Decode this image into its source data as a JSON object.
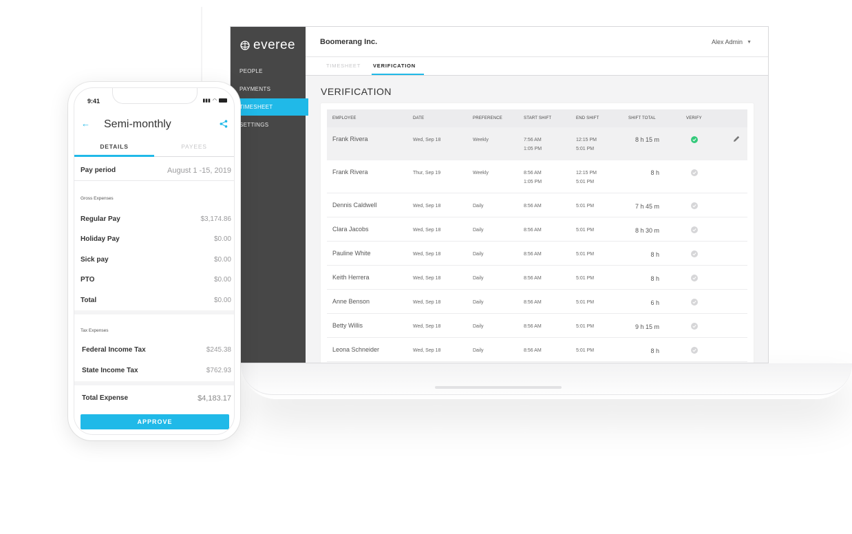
{
  "app": {
    "brand": "everee",
    "company": "Boomerang Inc.",
    "user": "Alex Admin"
  },
  "sidebar": {
    "items": [
      {
        "label": "PEOPLE"
      },
      {
        "label": "PAYMENTS"
      },
      {
        "label": "TIMESHEET",
        "active": true
      },
      {
        "label": "SETTINGS"
      }
    ]
  },
  "tabs": {
    "timesheet": "TIMESHEET",
    "verification": "VERIFICATION"
  },
  "main": {
    "title": "VERIFICATION",
    "columns": [
      "EMPLOYEE",
      "DATE",
      "PREFERENCE",
      "START SHIFT",
      "END SHIFT",
      "SHIFT TOTAL",
      "VERIFY"
    ],
    "rows": [
      {
        "employee": "Frank Rivera",
        "date": "Wed, Sep 18",
        "preference": "Weekly",
        "start": "7:56 AM",
        "start2": "1:05 PM",
        "end": "12:15 PM",
        "end2": "5:01 PM",
        "total": "8 h 15 m",
        "verified": true
      },
      {
        "employee": "Frank Rivera",
        "date": "Thur, Sep 19",
        "preference": "Weekly",
        "start": "8:56 AM",
        "start2": "1:05 PM",
        "end": "12:15 PM",
        "end2": "5:01 PM",
        "total": "8 h",
        "verified": false
      },
      {
        "employee": "Dennis Caldwell",
        "date": "Wed, Sep 18",
        "preference": "Daily",
        "start": "8:56 AM",
        "end": "5:01 PM",
        "total": "7 h 45 m",
        "verified": false
      },
      {
        "employee": "Clara Jacobs",
        "date": "Wed, Sep 18",
        "preference": "Daily",
        "start": "8:56 AM",
        "end": "5:01 PM",
        "total": "8 h 30 m",
        "verified": false
      },
      {
        "employee": "Pauline White",
        "date": "Wed, Sep 18",
        "preference": "Daily",
        "start": "8:56 AM",
        "end": "5:01 PM",
        "total": "8 h",
        "verified": false
      },
      {
        "employee": "Keith Herrera",
        "date": "Wed, Sep 18",
        "preference": "Daily",
        "start": "8:56 AM",
        "end": "5:01 PM",
        "total": "8 h",
        "verified": false
      },
      {
        "employee": "Anne Benson",
        "date": "Wed, Sep 18",
        "preference": "Daily",
        "start": "8:56 AM",
        "end": "5:01 PM",
        "total": "6 h",
        "verified": false
      },
      {
        "employee": "Betty Willis",
        "date": "Wed, Sep 18",
        "preference": "Daily",
        "start": "8:56 AM",
        "end": "5:01 PM",
        "total": "9 h 15 m",
        "verified": false
      },
      {
        "employee": "Leona Schneider",
        "date": "Wed, Sep 18",
        "preference": "Daily",
        "start": "8:56 AM",
        "end": "5:01 PM",
        "total": "8 h",
        "verified": false
      }
    ]
  },
  "colors": {
    "accent": "#20b9e8",
    "sidebar": "#474747",
    "verified": "#34c97b",
    "unverified": "#d6d6d8"
  },
  "phone": {
    "time": "9:41",
    "title": "Semi-monthly",
    "tab_details": "DETAILS",
    "tab_payees": "PAYEES",
    "pay_period_label": "Pay period",
    "pay_period_value": "August 1 -15, 2019",
    "gross_section": "Gross Expenses",
    "gross": [
      {
        "label": "Regular Pay",
        "value": "$3,174.86"
      },
      {
        "label": "Holiday Pay",
        "value": "$0.00"
      },
      {
        "label": "Sick pay",
        "value": "$0.00"
      },
      {
        "label": "PTO",
        "value": "$0.00"
      },
      {
        "label": "Total",
        "value": "$0.00"
      }
    ],
    "tax_section": "Tax Expenses",
    "tax": [
      {
        "label": "Federal Income Tax",
        "value": "$245.38"
      },
      {
        "label": "State Income Tax",
        "value": "$762.93"
      }
    ],
    "total_label": "Total Expense",
    "total_value": "$4,183.17",
    "approve_label": "APPROVE"
  }
}
